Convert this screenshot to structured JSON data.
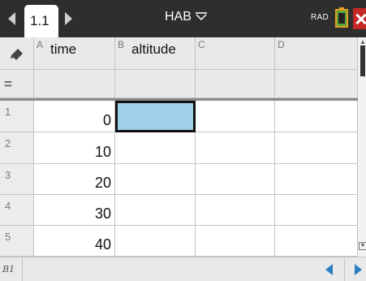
{
  "topbar": {
    "tab_label": "1.1",
    "doc_title": "HAB",
    "angle_mode": "RAD"
  },
  "grid": {
    "corner_icon": "pencil-eraser-icon",
    "columns": [
      {
        "letter": "A",
        "name": "time"
      },
      {
        "letter": "B",
        "name": "altitude"
      },
      {
        "letter": "C",
        "name": ""
      },
      {
        "letter": "D",
        "name": ""
      }
    ],
    "formula_symbol": "=",
    "rows": [
      {
        "num": "1",
        "a": "0",
        "b": ""
      },
      {
        "num": "2",
        "a": "10",
        "b": ""
      },
      {
        "num": "3",
        "a": "20",
        "b": ""
      },
      {
        "num": "4",
        "a": "30",
        "b": ""
      },
      {
        "num": "5",
        "a": "40",
        "b": ""
      }
    ],
    "selected_cell": "B1"
  },
  "bottombar": {
    "cell_reference": "B1"
  },
  "colors": {
    "selection_fill": "#9ed0e8",
    "topbar_bg": "#2e2e2e",
    "nav_arrow": "#2a7fc4",
    "close_red": "#c62828"
  }
}
